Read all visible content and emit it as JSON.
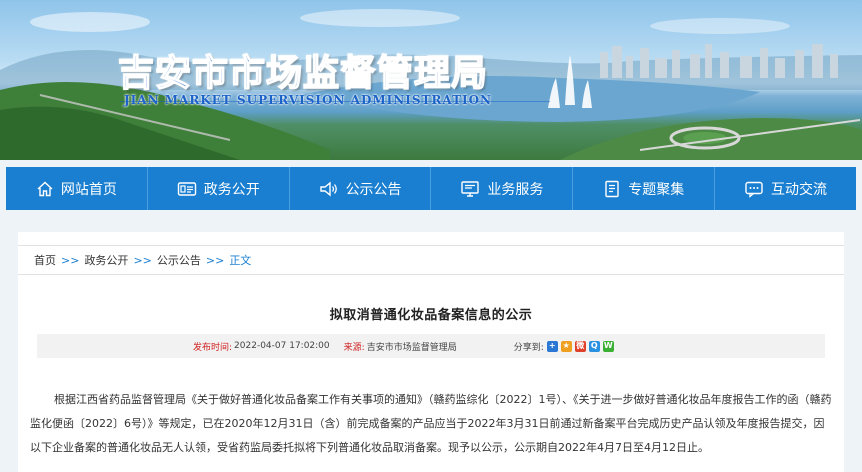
{
  "header": {
    "title": "吉安市市场监督管理局",
    "subtitle": "JIAN  MARKET  SUPERVISION  ADMINISTRATION"
  },
  "nav": [
    {
      "label": "网站首页",
      "icon": "home-icon"
    },
    {
      "label": "政务公开",
      "icon": "id-card-icon"
    },
    {
      "label": "公示公告",
      "icon": "speaker-icon"
    },
    {
      "label": "业务服务",
      "icon": "monitor-icon"
    },
    {
      "label": "专题聚集",
      "icon": "document-list-icon"
    },
    {
      "label": "互动交流",
      "icon": "chat-bubble-icon"
    }
  ],
  "breadcrumb": {
    "home": "首页",
    "sep": ">>",
    "level1": "政务公开",
    "level2": "公示公告",
    "current": "正文"
  },
  "article": {
    "title": "拟取消普通化妆品备案信息的公示",
    "publish_label": "发布时间:",
    "publish_date": "2022-04-07 17:02:00",
    "source_label": "来源:",
    "source": "吉安市市场监督管理局",
    "share_label": "分享到:",
    "body": "根据江西省药品监督管理局《关于做好普通化妆品备案工作有关事项的通知》（赣药监综化〔2022〕1号）、《关于进一步做好普通化妆品年度报告工作的函（赣药监化便函〔2022〕6号）》等规定，已在2020年12月31日（含）前完成备案的产品应当于2022年3月31日前通过新备案平台完成历史产品认领及年度报告提交，因以下企业备案的普通化妆品无人认领，受省药监局委托拟将下列普通化妆品取消备案。现予以公示，公示期自2022年4月7日至4月12日止。"
  },
  "share_buttons": [
    {
      "name": "share-plus-icon",
      "color": "#2a78d4",
      "glyph": "+"
    },
    {
      "name": "share-qzone-icon",
      "color": "#f0a020",
      "glyph": "★"
    },
    {
      "name": "share-weibo-icon",
      "color": "#e0402a",
      "glyph": "微"
    },
    {
      "name": "share-tencent-icon",
      "color": "#2a90e0",
      "glyph": "Q"
    },
    {
      "name": "share-wechat-icon",
      "color": "#3cb034",
      "glyph": "W"
    }
  ],
  "colors": {
    "nav_bg": "#1a7fd0",
    "title_blue": "#1c63c7",
    "label_red": "#d02020",
    "page_bg": "#eef3f8"
  }
}
